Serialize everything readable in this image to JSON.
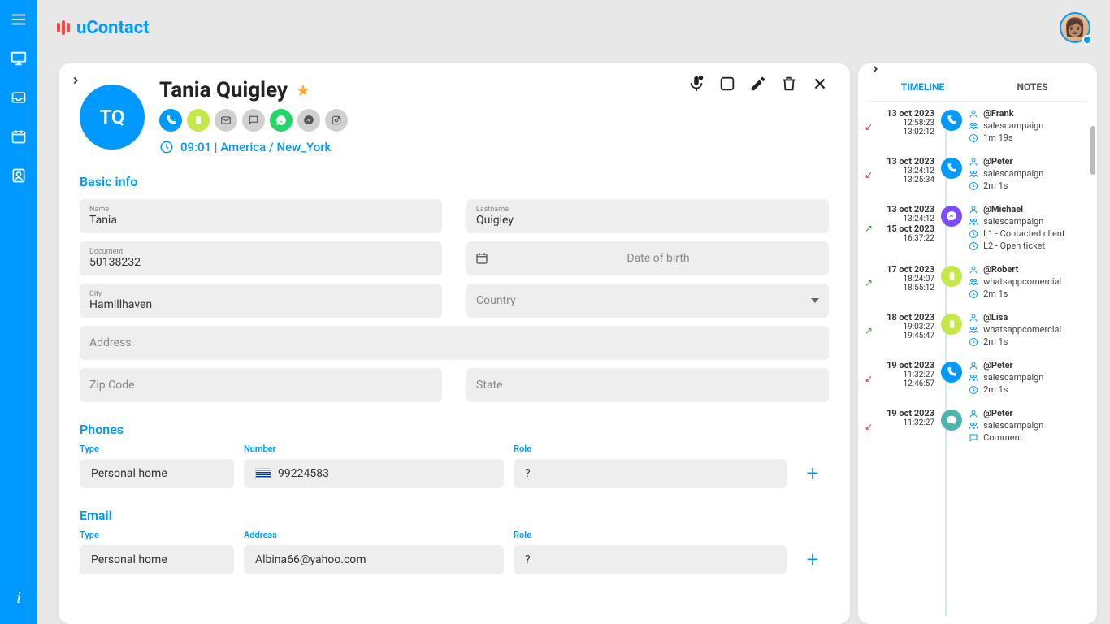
{
  "brand": "uContact",
  "contact": {
    "initials": "TQ",
    "fullName": "Tania Quigley",
    "timezone": "09:01 | America / New_York"
  },
  "sections": {
    "basic": "Basic info",
    "phones": "Phones",
    "email": "Email"
  },
  "fields": {
    "name_label": "Name",
    "name_value": "Tania",
    "lastname_label": "Lastname",
    "lastname_value": "Quigley",
    "document_label": "Document",
    "document_value": "50138232",
    "dob_placeholder": "Date of birth",
    "city_label": "City",
    "city_value": "Hamillhaven",
    "country_placeholder": "Country",
    "address_placeholder": "Address",
    "zip_placeholder": "Zip Code",
    "state_placeholder": "State"
  },
  "columns": {
    "type": "Type",
    "number": "Number",
    "address": "Address",
    "role": "Role"
  },
  "phoneRow": {
    "type": "Personal home",
    "number": "99224583",
    "role": "?"
  },
  "emailRow": {
    "type": "Personal home",
    "address": "Albina66@yahoo.com",
    "role": "?"
  },
  "tabs": {
    "timeline": "TIMELINE",
    "notes": "NOTES"
  },
  "timeline": [
    {
      "dir": "in",
      "type": "call",
      "date": "13 oct 2023",
      "t1": "12:58:23",
      "t2": "13:02:12",
      "agent": "@Frank",
      "campaign": "salescampaign",
      "dur": "1m 19s",
      "extra": []
    },
    {
      "dir": "in",
      "type": "call",
      "date": "13 oct 2023",
      "t1": "13:24:12",
      "t2": "13:25:34",
      "agent": "@Peter",
      "campaign": "salescampaign",
      "dur": "2m 1s",
      "extra": []
    },
    {
      "dir": "out",
      "type": "fb",
      "date": "13 oct 2023",
      "t1": "13:24:12",
      "date2": "15 oct 2023",
      "t2": "16:37:22",
      "agent": "@Michael",
      "campaign": "salescampaign",
      "dur": "L1 - Contacted client",
      "extra": [
        "L2 - Open ticket"
      ]
    },
    {
      "dir": "out",
      "type": "mobile",
      "date": "17 oct 2023",
      "t1": "18:24:07",
      "t2": "18:55:12",
      "agent": "@Robert",
      "campaign": "whatsappcomercial",
      "dur": "2m 1s",
      "extra": []
    },
    {
      "dir": "out",
      "type": "mobile",
      "date": "18 oct 2023",
      "t1": "19:03:27",
      "t2": "19:45:47",
      "agent": "@Lisa",
      "campaign": "whatsappcomercial",
      "dur": "2m 1s",
      "extra": []
    },
    {
      "dir": "in",
      "type": "call",
      "date": "19 oct 2023",
      "t1": "11:32:27",
      "t2": "12:46:57",
      "agent": "@Peter",
      "campaign": "salescampaign",
      "dur": "2m 1s",
      "extra": []
    },
    {
      "dir": "in",
      "type": "chat",
      "date": "19 oct 2023",
      "t1": "11:32:27",
      "t2": "",
      "agent": "@Peter",
      "campaign": "salescampaign",
      "dur": "Comment",
      "extra": []
    }
  ]
}
